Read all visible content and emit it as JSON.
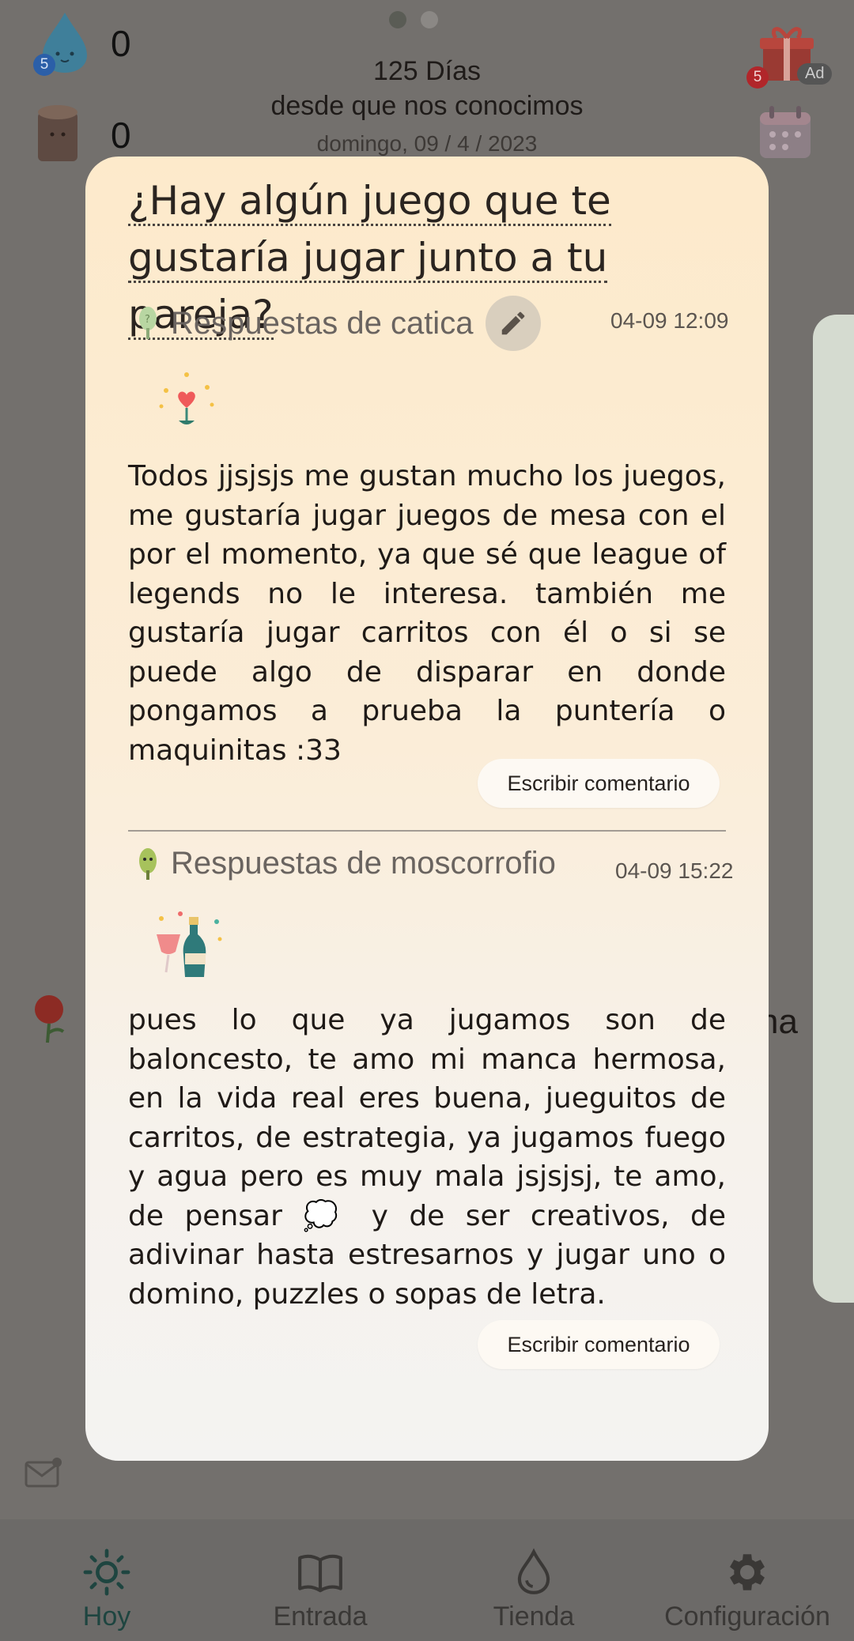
{
  "header": {
    "water_count": "0",
    "wood_count": "0",
    "water_badge": "5",
    "days_label": "125 Días",
    "subtitle": "desde que nos conocimos",
    "date": "domingo, 09 / 4 / 2023",
    "gift_badge": "5",
    "ad_label": "Ad"
  },
  "background": {
    "partial_text": "na"
  },
  "modal": {
    "question": "¿Hay algún juego que te gustaría jugar junto a tu pareja?",
    "answers": [
      {
        "title": "Respuestas de catica",
        "timestamp": "04-09 12:09",
        "text": "Todos jjsjsjs me gustan mucho los juegos, me gustaría jugar juegos de mesa con el por el momento, ya que sé que league of legends no le interesa. también me gustaría jugar carritos con él o si se puede algo de disparar en donde pongamos a prueba la puntería o maquinitas :33",
        "comment_button": "Escribir comentario"
      },
      {
        "title": "Respuestas de moscorrofio",
        "timestamp": "04-09 15:22",
        "text": "pues lo que ya jugamos son de baloncesto, te amo mi manca hermosa, en la vida real eres buena, jueguitos de carritos, de estrategia, ya jugamos fuego y agua pero es muy mala jsjsjsj, te amo, de pensar 💭 y de ser creativos, de adivinar hasta estresarnos y jugar uno o domino, puzzles o sopas de letra.",
        "comment_button": "Escribir comentario"
      }
    ]
  },
  "nav": {
    "items": [
      {
        "label": "Hoy",
        "icon": "sun-icon",
        "active": true
      },
      {
        "label": "Entrada",
        "icon": "book-icon",
        "active": false
      },
      {
        "label": "Tienda",
        "icon": "drop-icon",
        "active": false
      },
      {
        "label": "Configuración",
        "icon": "gear-icon",
        "active": false
      }
    ]
  }
}
